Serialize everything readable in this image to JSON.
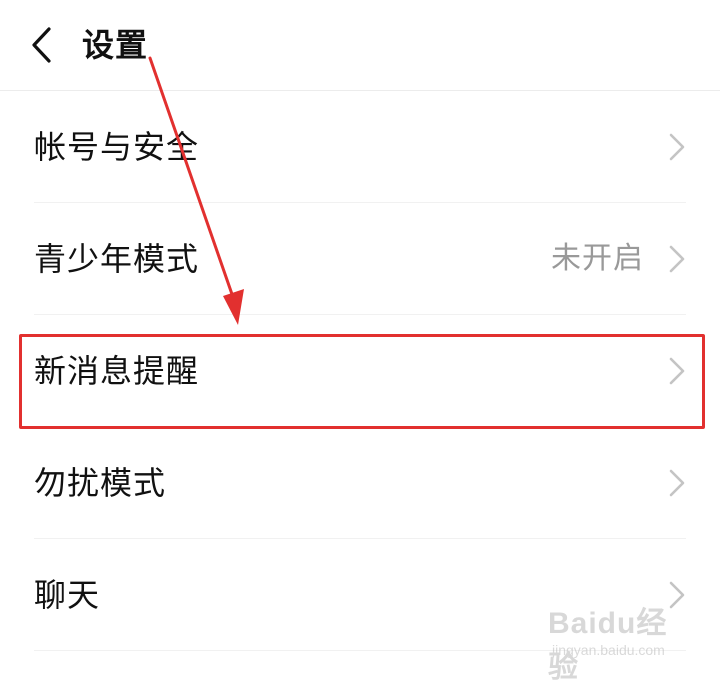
{
  "header": {
    "title": "设置",
    "back_icon": "chevron-left-icon"
  },
  "rows": [
    {
      "label": "帐号与安全",
      "value": ""
    },
    {
      "label": "青少年模式",
      "value": "未开启"
    },
    {
      "label": "新消息提醒",
      "value": ""
    },
    {
      "label": "勿扰模式",
      "value": ""
    },
    {
      "label": "聊天",
      "value": ""
    }
  ],
  "annotation": {
    "highlighted_row": "新消息提醒",
    "color": "#e2302f"
  },
  "watermark": {
    "brand": "Baidu经验",
    "url": "jingyan.baidu.com"
  }
}
